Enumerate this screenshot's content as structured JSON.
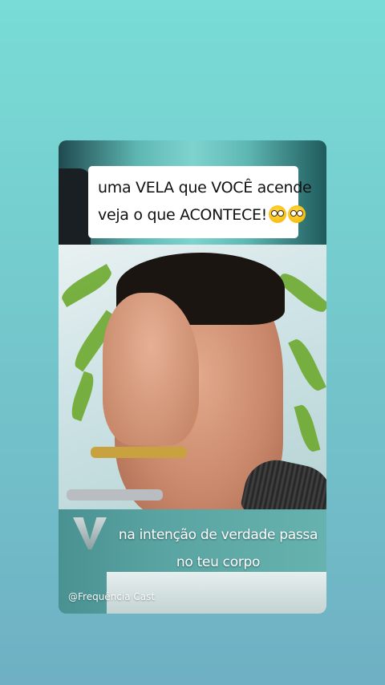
{
  "caption_top": {
    "line1": "uma VELA que VOCÊ acende",
    "line2": "veja o que ACONTECE!",
    "emoji": "flushed-face-emoji"
  },
  "caption_bottom": {
    "line1": "na intenção de verdade passa",
    "line2": "no teu corpo"
  },
  "watermark": "@Frequência Cast",
  "colors": {
    "background_top": "#79dcd6",
    "background_bottom": "#6fb0c4",
    "caption_box": "#ffffff"
  }
}
